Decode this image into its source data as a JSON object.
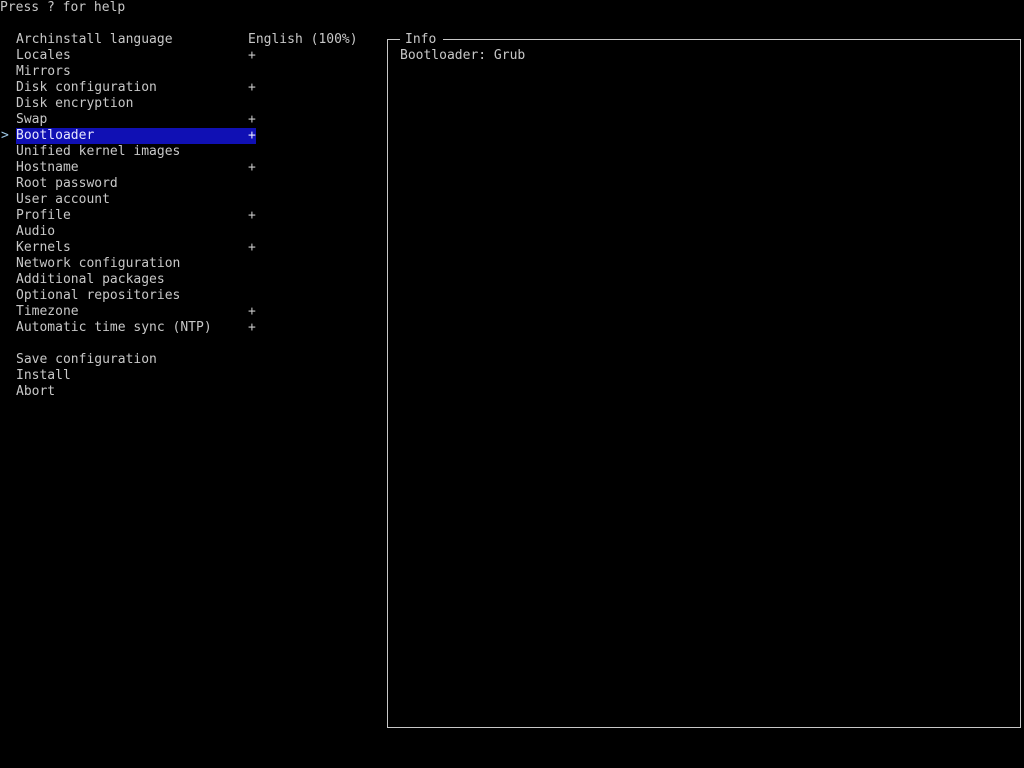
{
  "help_text": "Press ? for help",
  "colors": {
    "background": "#000000",
    "text": "#c8c8c8",
    "selection_bg": "#1010b4",
    "cursor": "#9ec8e6"
  },
  "cursor_icon": "chevron-right-icon",
  "cursor_glyph": ">",
  "menu": {
    "language_value": "English (100%)",
    "items": [
      {
        "label": "Archinstall language",
        "mark": ""
      },
      {
        "label": "Locales",
        "mark": "+"
      },
      {
        "label": "Mirrors",
        "mark": ""
      },
      {
        "label": "Disk configuration",
        "mark": "+"
      },
      {
        "label": "Disk encryption",
        "mark": ""
      },
      {
        "label": "Swap",
        "mark": "+"
      },
      {
        "label": "Bootloader",
        "mark": "+"
      },
      {
        "label": "Unified kernel images",
        "mark": ""
      },
      {
        "label": "Hostname",
        "mark": "+"
      },
      {
        "label": "Root password",
        "mark": ""
      },
      {
        "label": "User account",
        "mark": ""
      },
      {
        "label": "Profile",
        "mark": "+"
      },
      {
        "label": "Audio",
        "mark": ""
      },
      {
        "label": "Kernels",
        "mark": "+"
      },
      {
        "label": "Network configuration",
        "mark": ""
      },
      {
        "label": "Additional packages",
        "mark": ""
      },
      {
        "label": "Optional repositories",
        "mark": ""
      },
      {
        "label": "Timezone",
        "mark": "+"
      },
      {
        "label": "Automatic time sync (NTP)",
        "mark": "+"
      }
    ],
    "actions": [
      {
        "label": "Save configuration"
      },
      {
        "label": "Install"
      },
      {
        "label": "Abort"
      }
    ],
    "selected": "Bootloader"
  },
  "info": {
    "title": "Info",
    "text": "Bootloader: Grub"
  }
}
